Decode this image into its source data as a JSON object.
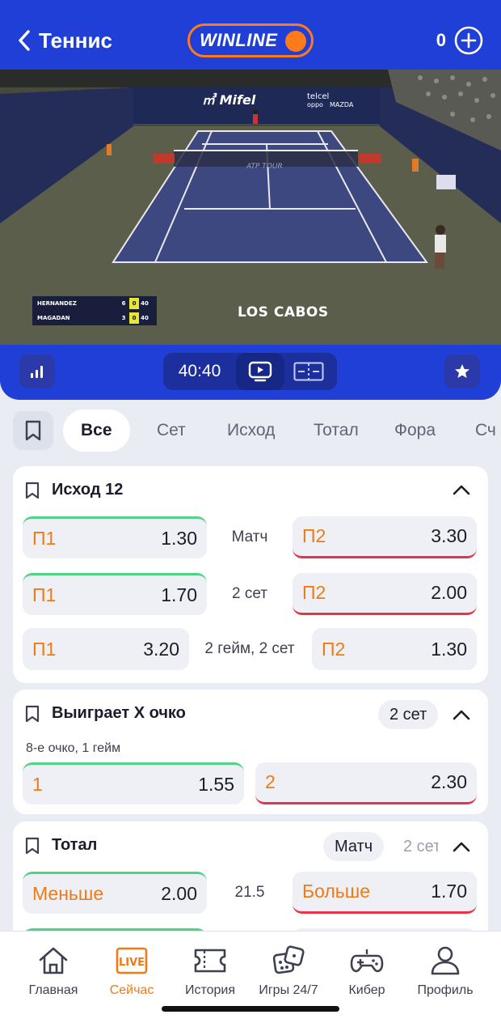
{
  "header": {
    "back_label": "Теннис",
    "logo_text": "WINLINE",
    "balance": "0",
    "brand_color": "#1f3fd6",
    "accent_color": "#ff7a1a"
  },
  "video": {
    "players": [
      {
        "name": "HERNANDEZ",
        "sets": "6",
        "games": "0",
        "points": "40"
      },
      {
        "name": "MAGADAN",
        "sets": "3",
        "games": "0",
        "points": "40"
      }
    ],
    "overlay_text": "LOS CABOS",
    "court_sponsors": [
      "Mifel",
      "telcel",
      "oppo",
      "MAZDA",
      "ATP TOUR"
    ]
  },
  "controls": {
    "score": "40:40",
    "stats_icon": "bar-chart-icon",
    "video_icon": "tv-play-icon",
    "field_icon": "court-icon",
    "favorite_icon": "star-icon"
  },
  "tabs": {
    "items": [
      "Все",
      "Сет",
      "Исход",
      "Тотал",
      "Фора",
      "Сч"
    ],
    "active": "Все"
  },
  "markets": {
    "outcome12": {
      "title": "Исход 12",
      "rows": [
        {
          "p1_label": "П1",
          "p1": "1.30",
          "middle": "Матч",
          "p2_label": "П2",
          "p2": "3.30"
        },
        {
          "p1_label": "П1",
          "p1": "1.70",
          "middle": "2 сет",
          "p2_label": "П2",
          "p2": "2.00"
        },
        {
          "p1_label": "П1",
          "p1": "3.20",
          "middle": "2 гейм, 2 сет",
          "p2_label": "П2",
          "p2": "1.30"
        }
      ]
    },
    "point_winner": {
      "title": "Выиграет X очко",
      "filter": "2 сет",
      "subtitle": "8-е очко, 1 гейм",
      "option1_label": "1",
      "option1": "1.55",
      "option2_label": "2",
      "option2": "2.30"
    },
    "total": {
      "title": "Тотал",
      "filter_active": "Матч",
      "filter_next": "2 сет",
      "under_label": "Меньше",
      "under": "2.00",
      "line": "21.5",
      "over_label": "Больше",
      "over": "1.70"
    }
  },
  "bottom_nav": {
    "items": [
      {
        "label": "Главная",
        "icon": "home-icon"
      },
      {
        "label": "Сейчас",
        "icon": "live-icon",
        "badge": "LIVE"
      },
      {
        "label": "История",
        "icon": "ticket-icon"
      },
      {
        "label": "Игры 24/7",
        "icon": "dice-icon"
      },
      {
        "label": "Кибер",
        "icon": "gamepad-icon"
      },
      {
        "label": "Профиль",
        "icon": "profile-icon"
      }
    ],
    "active": "Сейчас"
  }
}
